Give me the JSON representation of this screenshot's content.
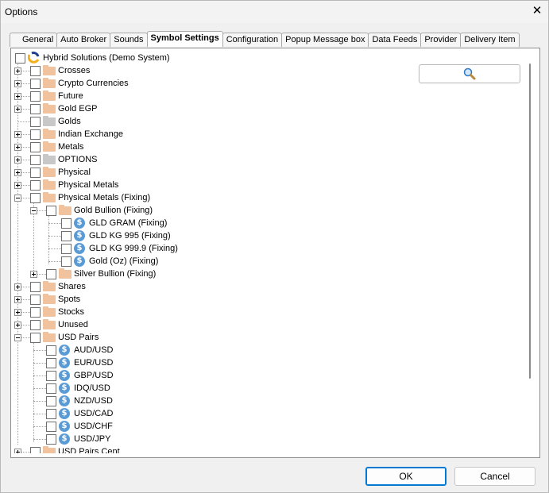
{
  "window": {
    "title": "Options",
    "close_glyph": "✕"
  },
  "tabs": [
    {
      "label": "General",
      "active": false
    },
    {
      "label": "Auto Broker",
      "active": false
    },
    {
      "label": "Sounds",
      "active": false
    },
    {
      "label": "Symbol Settings",
      "active": true
    },
    {
      "label": "Configuration",
      "active": false
    },
    {
      "label": "Popup Message box",
      "active": false
    },
    {
      "label": "Data Feeds",
      "active": false
    },
    {
      "label": "Provider",
      "active": false
    },
    {
      "label": "Delivery Item",
      "active": false
    }
  ],
  "tree": [
    {
      "label": "Hybrid Solutions (Demo System)",
      "level": 0,
      "icon": "logo-icon",
      "expander": "none"
    },
    {
      "label": "Crosses",
      "level": 1,
      "icon": "folder-icon",
      "expander": "plus"
    },
    {
      "label": "Crypto Currencies",
      "level": 1,
      "icon": "folder-icon",
      "expander": "plus"
    },
    {
      "label": "Future",
      "level": 1,
      "icon": "folder-icon",
      "expander": "plus"
    },
    {
      "label": "Gold EGP",
      "level": 1,
      "icon": "folder-icon",
      "expander": "plus"
    },
    {
      "label": "Golds",
      "level": 1,
      "icon": "gray-folder-icon",
      "expander": "none"
    },
    {
      "label": "Indian Exchange",
      "level": 1,
      "icon": "folder-icon",
      "expander": "plus"
    },
    {
      "label": "Metals",
      "level": 1,
      "icon": "folder-icon",
      "expander": "plus"
    },
    {
      "label": "OPTIONS",
      "level": 1,
      "icon": "gray-folder-icon",
      "expander": "plus"
    },
    {
      "label": "Physical",
      "level": 1,
      "icon": "folder-icon",
      "expander": "plus"
    },
    {
      "label": "Physical Metals",
      "level": 1,
      "icon": "folder-icon",
      "expander": "plus"
    },
    {
      "label": "Physical Metals (Fixing)",
      "level": 1,
      "icon": "folder-icon",
      "expander": "minus"
    },
    {
      "label": "Gold Bullion (Fixing)",
      "level": 2,
      "icon": "folder-icon",
      "expander": "minus"
    },
    {
      "label": "GLD GRAM (Fixing)",
      "level": 3,
      "icon": "dollar-coin-icon",
      "expander": "none"
    },
    {
      "label": "GLD KG 995 (Fixing)",
      "level": 3,
      "icon": "dollar-coin-icon",
      "expander": "none"
    },
    {
      "label": "GLD KG 999.9 (Fixing)",
      "level": 3,
      "icon": "dollar-coin-icon",
      "expander": "none"
    },
    {
      "label": "Gold (Oz) (Fixing)",
      "level": 3,
      "icon": "dollar-coin-icon",
      "expander": "none"
    },
    {
      "label": "Silver Bullion (Fixing)",
      "level": 2,
      "icon": "folder-icon",
      "expander": "plus"
    },
    {
      "label": "Shares",
      "level": 1,
      "icon": "folder-icon",
      "expander": "plus"
    },
    {
      "label": "Spots",
      "level": 1,
      "icon": "folder-icon",
      "expander": "plus"
    },
    {
      "label": "Stocks",
      "level": 1,
      "icon": "folder-icon",
      "expander": "plus"
    },
    {
      "label": "Unused",
      "level": 1,
      "icon": "folder-icon",
      "expander": "plus"
    },
    {
      "label": "USD Pairs",
      "level": 1,
      "icon": "folder-icon",
      "expander": "minus"
    },
    {
      "label": "AUD/USD",
      "level": 2,
      "icon": "dollar-coin-icon",
      "expander": "none"
    },
    {
      "label": "EUR/USD",
      "level": 2,
      "icon": "dollar-coin-icon",
      "expander": "none"
    },
    {
      "label": "GBP/USD",
      "level": 2,
      "icon": "dollar-coin-icon",
      "expander": "none"
    },
    {
      "label": "IDQ/USD",
      "level": 2,
      "icon": "dollar-coin-icon",
      "expander": "none"
    },
    {
      "label": "NZD/USD",
      "level": 2,
      "icon": "dollar-coin-icon",
      "expander": "none"
    },
    {
      "label": "USD/CAD",
      "level": 2,
      "icon": "dollar-coin-icon",
      "expander": "none"
    },
    {
      "label": "USD/CHF",
      "level": 2,
      "icon": "dollar-coin-icon",
      "expander": "none"
    },
    {
      "label": "USD/JPY",
      "level": 2,
      "icon": "dollar-coin-icon",
      "expander": "none"
    },
    {
      "label": "USD Pairs Cent",
      "level": 1,
      "icon": "folder-icon",
      "expander": "plus"
    }
  ],
  "search_button": {
    "icon": "magnifier-icon"
  },
  "buttons": {
    "ok": "OK",
    "cancel": "Cancel"
  },
  "colors": {
    "folder": "#f0c29e",
    "coin": "#5b9bd5",
    "ok_border": "#0078d4"
  }
}
